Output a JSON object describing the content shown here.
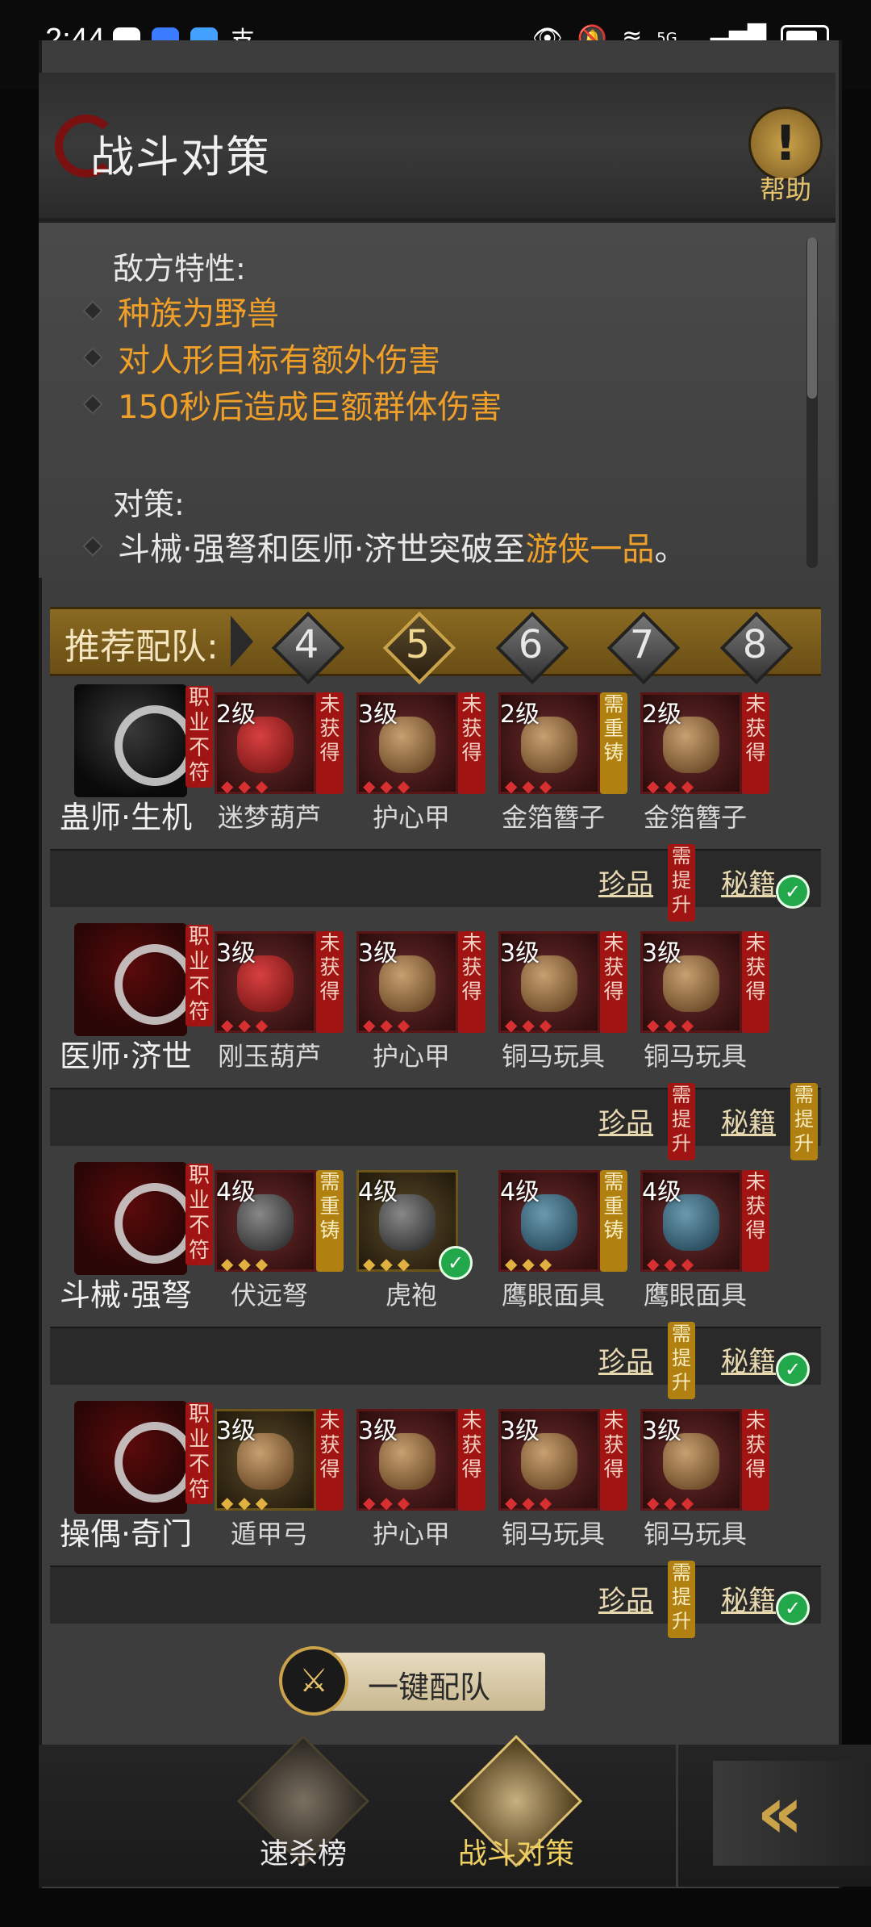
{
  "status": {
    "time": "2:44",
    "network": "5G"
  },
  "header": {
    "title": "战斗对策",
    "help_label": "帮助"
  },
  "info": {
    "enemy_title": "敌方特性:",
    "enemy_traits": [
      "种族为野兽",
      "对人形目标有额外伤害",
      "150秒后造成巨额群体伤害"
    ],
    "strategy_title": "对策:",
    "strategy_pre": "斗械·强弩和医师·济世突破至",
    "strategy_hl": "游侠一品",
    "strategy_post": "。"
  },
  "recommend": {
    "label": "推荐配队:",
    "options": [
      "4",
      "5",
      "6",
      "7",
      "8"
    ],
    "selected": "5"
  },
  "teams": [
    {
      "role": "蛊师·生机",
      "role_tag": "职业不符",
      "items": [
        {
          "level": "2级",
          "name": "迷梦葫芦",
          "status": "未获得",
          "status_color": "red",
          "glyph": "gourd-icon"
        },
        {
          "level": "3级",
          "name": "护心甲",
          "status": "未获得",
          "status_color": "red",
          "glyph": "armor-icon"
        },
        {
          "level": "2级",
          "name": "金箔簪子",
          "status": "需重铸",
          "status_color": "gold",
          "glyph": "hairpin-icon"
        },
        {
          "level": "2级",
          "name": "金箔簪子",
          "status": "未获得",
          "status_color": "red",
          "glyph": "hairpin-icon"
        }
      ],
      "treasure": "珍品",
      "treasure_status": "需提升",
      "treasure_status_color": "red",
      "secret": "秘籍",
      "secret_ok": true
    },
    {
      "role": "医师·济世",
      "role_tag": "职业不符",
      "items": [
        {
          "level": "3级",
          "name": "刚玉葫芦",
          "status": "未获得",
          "status_color": "red",
          "glyph": "gourd-icon"
        },
        {
          "level": "3级",
          "name": "护心甲",
          "status": "未获得",
          "status_color": "red",
          "glyph": "armor-icon"
        },
        {
          "level": "3级",
          "name": "铜马玩具",
          "status": "未获得",
          "status_color": "red",
          "glyph": "horse-toy-icon"
        },
        {
          "level": "3级",
          "name": "铜马玩具",
          "status": "未获得",
          "status_color": "red",
          "glyph": "horse-toy-icon"
        }
      ],
      "treasure": "珍品",
      "treasure_status": "需提升",
      "treasure_status_color": "red",
      "secret": "秘籍",
      "secret_status": "需提升",
      "secret_status_color": "gold"
    },
    {
      "role": "斗械·强弩",
      "role_tag": "职业不符",
      "items": [
        {
          "level": "4级",
          "name": "伏远弩",
          "status": "需重铸",
          "status_color": "gold",
          "glyph": "crossbow-icon"
        },
        {
          "level": "4级",
          "name": "虎袍",
          "ok": true,
          "glyph": "robe-icon"
        },
        {
          "level": "4级",
          "name": "鹰眼面具",
          "status": "需重铸",
          "status_color": "gold",
          "glyph": "mask-icon"
        },
        {
          "level": "4级",
          "name": "鹰眼面具",
          "status": "未获得",
          "status_color": "red",
          "glyph": "mask-icon"
        }
      ],
      "treasure": "珍品",
      "treasure_status": "需提升",
      "treasure_status_color": "gold",
      "secret": "秘籍",
      "secret_ok": true
    },
    {
      "role": "操偶·奇门",
      "role_tag": "职业不符",
      "items": [
        {
          "level": "3级",
          "name": "遁甲弓",
          "status": "未获得",
          "status_color": "red",
          "glyph": "bow-icon"
        },
        {
          "level": "3级",
          "name": "护心甲",
          "status": "未获得",
          "status_color": "red",
          "glyph": "armor-icon"
        },
        {
          "level": "3级",
          "name": "铜马玩具",
          "status": "未获得",
          "status_color": "red",
          "glyph": "horse-toy-icon"
        },
        {
          "level": "3级",
          "name": "铜马玩具",
          "status": "未获得",
          "status_color": "red",
          "glyph": "horse-toy-icon"
        }
      ],
      "treasure": "珍品",
      "treasure_status": "需提升",
      "treasure_status_color": "gold",
      "secret": "秘籍",
      "secret_ok": true
    }
  ],
  "onekey_label": "一键配队",
  "nav": {
    "items": [
      {
        "label": "速杀榜"
      },
      {
        "label": "战斗对策"
      }
    ],
    "active": "战斗对策"
  }
}
